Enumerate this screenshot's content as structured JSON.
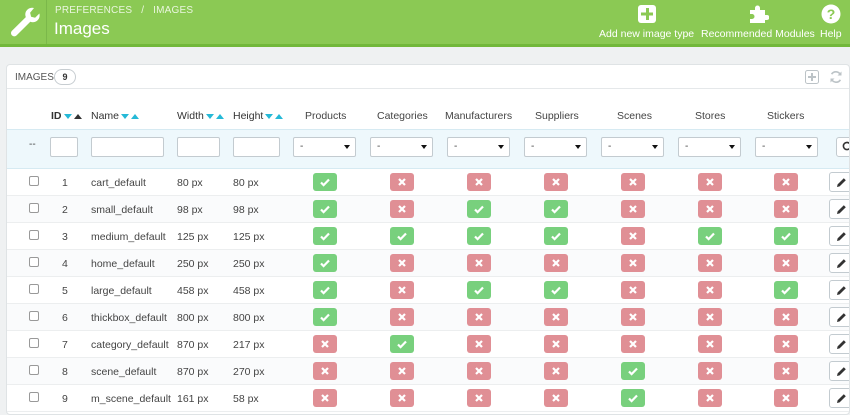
{
  "header": {
    "breadcrumbs": [
      "PREFERENCES",
      "/",
      "IMAGES"
    ],
    "title": "Images",
    "toolbar": [
      {
        "label": "Add new image type",
        "icon": "plus-square-icon"
      },
      {
        "label": "Recommended Modules",
        "icon": "puzzle-icon"
      },
      {
        "label": "Help",
        "icon": "help-circle-icon"
      }
    ],
    "colors": {
      "header": "#8bc954",
      "accent": "#25b9d7"
    }
  },
  "panel": {
    "title": "IMAGES",
    "count": "9"
  },
  "table": {
    "columns": [
      "ID",
      "Name",
      "Width",
      "Height",
      "Products",
      "Categories",
      "Manufacturers",
      "Suppliers",
      "Scenes",
      "Stores",
      "Stickers"
    ],
    "filter_dash": "--",
    "select_default": "-",
    "rows": [
      {
        "id": "1",
        "name": "cart_default",
        "width": "80 px",
        "height": "80 px",
        "flags": [
          true,
          false,
          false,
          false,
          false,
          false,
          false
        ]
      },
      {
        "id": "2",
        "name": "small_default",
        "width": "98 px",
        "height": "98 px",
        "flags": [
          true,
          false,
          true,
          true,
          false,
          false,
          false
        ]
      },
      {
        "id": "3",
        "name": "medium_default",
        "width": "125 px",
        "height": "125 px",
        "flags": [
          true,
          true,
          true,
          true,
          false,
          true,
          true
        ]
      },
      {
        "id": "4",
        "name": "home_default",
        "width": "250 px",
        "height": "250 px",
        "flags": [
          true,
          false,
          false,
          false,
          false,
          false,
          false
        ]
      },
      {
        "id": "5",
        "name": "large_default",
        "width": "458 px",
        "height": "458 px",
        "flags": [
          true,
          false,
          true,
          true,
          false,
          false,
          true
        ]
      },
      {
        "id": "6",
        "name": "thickbox_default",
        "width": "800 px",
        "height": "800 px",
        "flags": [
          true,
          false,
          false,
          false,
          false,
          false,
          false
        ]
      },
      {
        "id": "7",
        "name": "category_default",
        "width": "870 px",
        "height": "217 px",
        "flags": [
          false,
          true,
          false,
          false,
          false,
          false,
          false
        ]
      },
      {
        "id": "8",
        "name": "scene_default",
        "width": "870 px",
        "height": "270 px",
        "flags": [
          false,
          false,
          false,
          false,
          true,
          false,
          false
        ]
      },
      {
        "id": "9",
        "name": "m_scene_default",
        "width": "161 px",
        "height": "58 px",
        "flags": [
          false,
          false,
          false,
          false,
          true,
          false,
          false
        ]
      }
    ]
  }
}
